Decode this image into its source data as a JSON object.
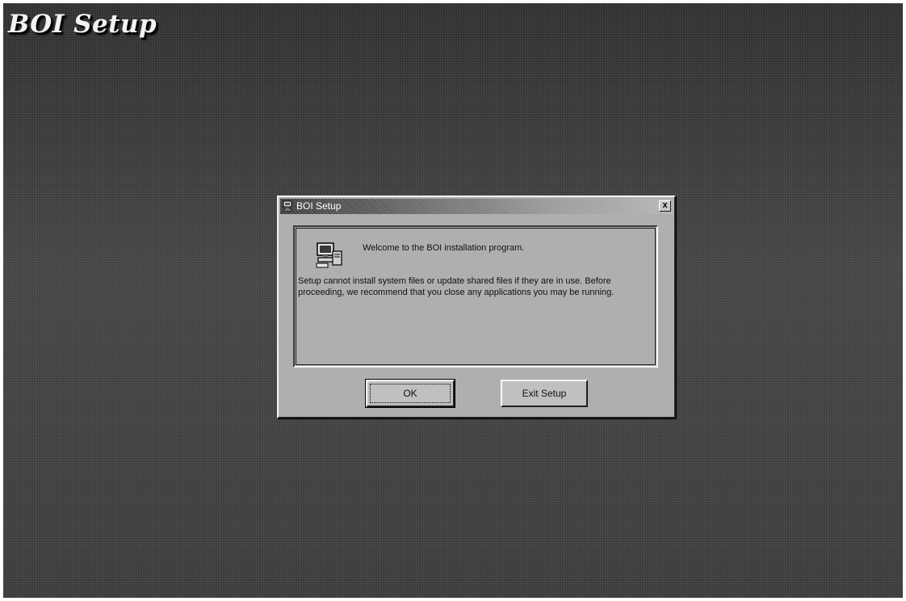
{
  "app": {
    "title": "BOI Setup"
  },
  "dialog": {
    "title": "BOI Setup",
    "close_label": "x",
    "welcome": "Welcome to the BOI installation program.",
    "message": "Setup cannot install system files or update shared files if they are in use. Before proceeding, we recommend that you close any applications you may be running."
  },
  "buttons": {
    "ok_label": "OK",
    "exit_label": "Exit Setup"
  },
  "icons": {
    "title_icon": "setup-computer-icon",
    "dialog_icon": "setup-computer-icon"
  }
}
